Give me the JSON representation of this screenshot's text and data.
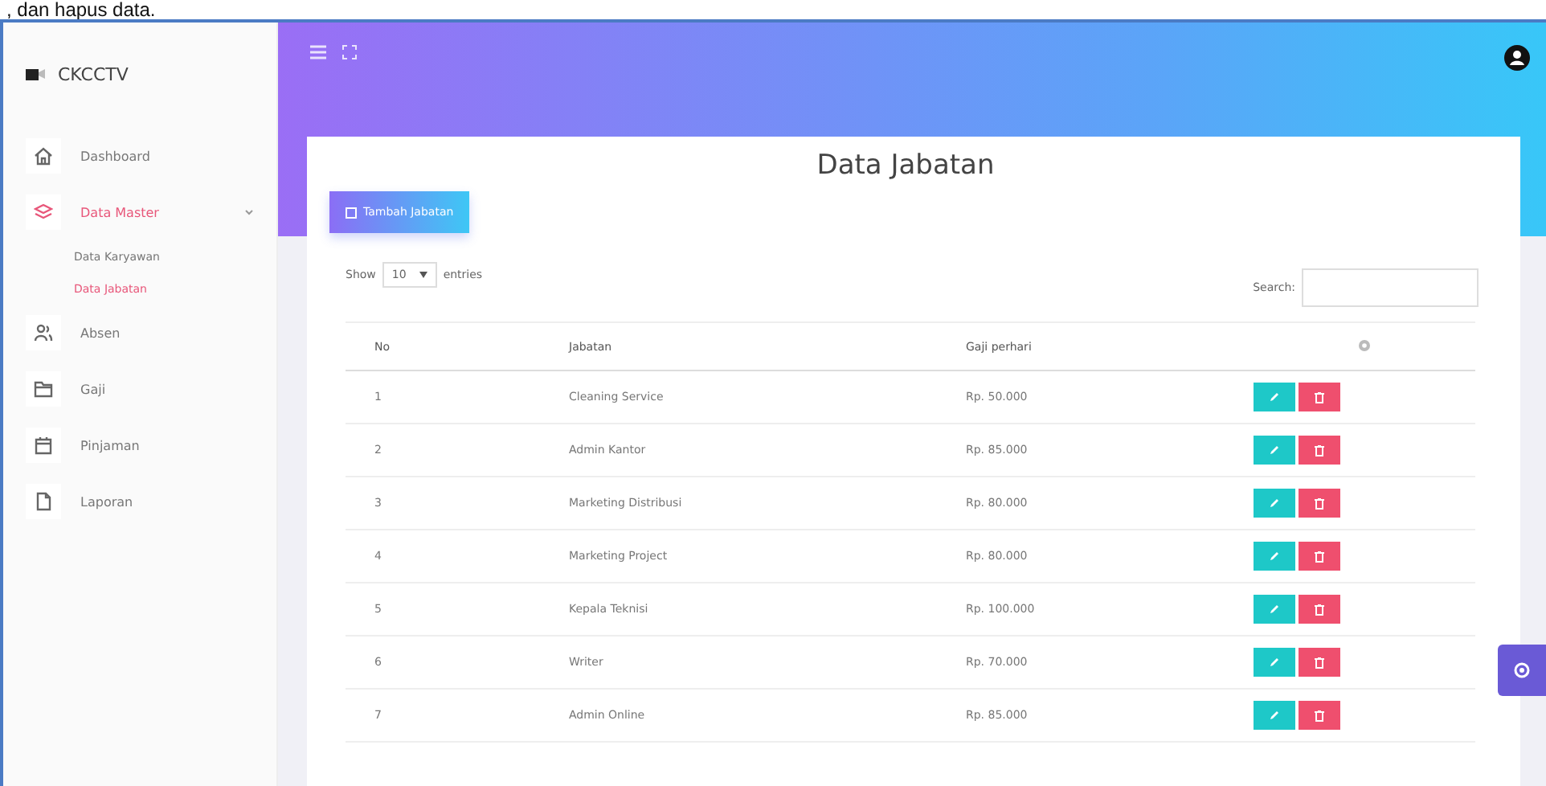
{
  "caption": ", dan hapus data.",
  "sidebar": {
    "brand": "CKCCTV",
    "items": [
      {
        "label": "Dashboard",
        "selected": false
      },
      {
        "label": "Data Master",
        "selected": true,
        "expanded": true,
        "children": [
          {
            "label": "Data Karyawan",
            "selected": false
          },
          {
            "label": "Data Jabatan",
            "selected": true
          }
        ]
      },
      {
        "label": "Absen",
        "selected": false
      },
      {
        "label": "Gaji",
        "selected": false
      },
      {
        "label": "Pinjaman",
        "selected": false
      },
      {
        "label": "Laporan",
        "selected": false
      }
    ]
  },
  "page": {
    "title": "Data Jabatan",
    "add_button": "Tambah Jabatan"
  },
  "table": {
    "show_label": "Show",
    "page_size": "10",
    "entries_label": "entries",
    "search_label": "Search:",
    "columns": [
      "No",
      "Jabatan",
      "Gaji perhari"
    ],
    "rows": [
      {
        "no": "1",
        "jabatan": "Cleaning Service",
        "gaji": "Rp. 50.000"
      },
      {
        "no": "2",
        "jabatan": "Admin Kantor",
        "gaji": "Rp. 85.000"
      },
      {
        "no": "3",
        "jabatan": "Marketing Distribusi",
        "gaji": "Rp. 80.000"
      },
      {
        "no": "4",
        "jabatan": "Marketing Project",
        "gaji": "Rp. 80.000"
      },
      {
        "no": "5",
        "jabatan": "Kepala Teknisi",
        "gaji": "Rp. 100.000"
      },
      {
        "no": "6",
        "jabatan": "Writer",
        "gaji": "Rp. 70.000"
      },
      {
        "no": "7",
        "jabatan": "Admin Online",
        "gaji": "Rp. 85.000"
      }
    ]
  }
}
